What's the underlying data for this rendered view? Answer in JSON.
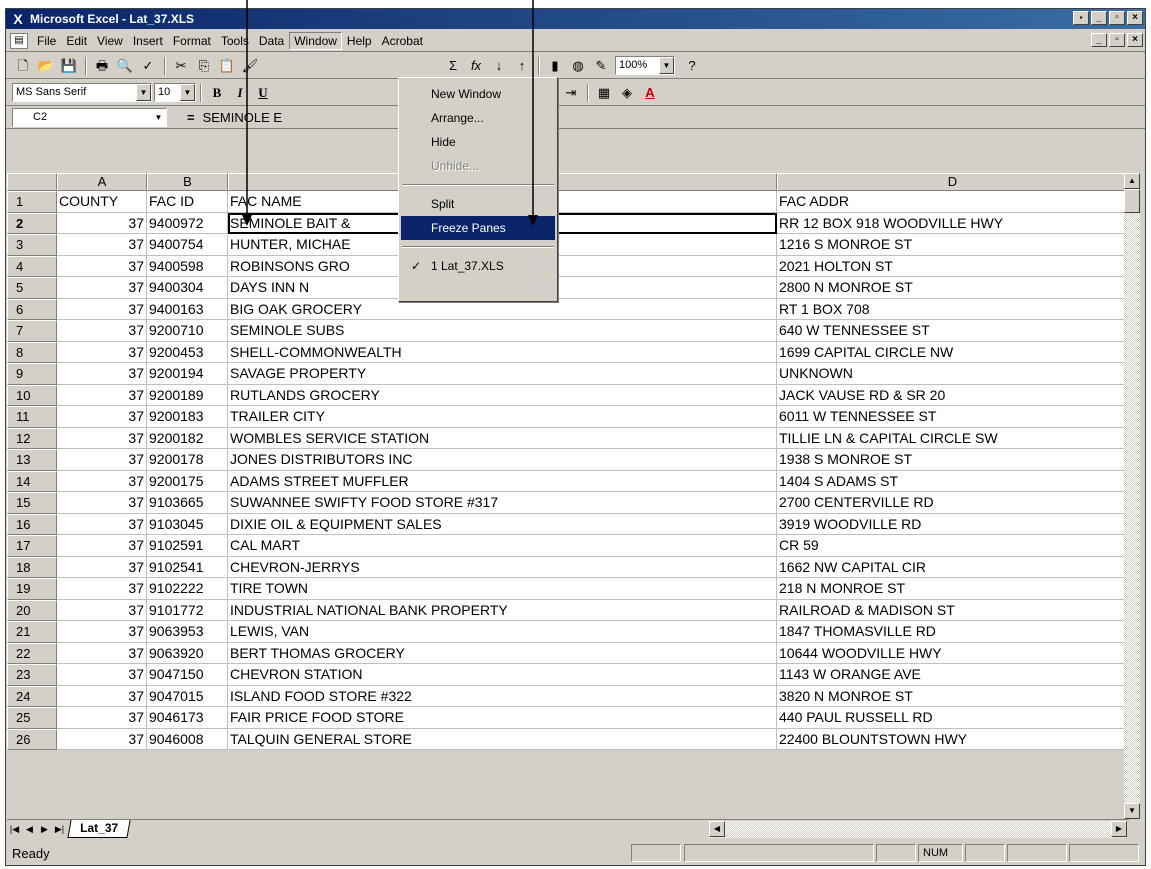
{
  "window": {
    "title": "Microsoft Excel - Lat_37.XLS",
    "app_icon": "excel-icon"
  },
  "menu": {
    "items": [
      "File",
      "Edit",
      "View",
      "Insert",
      "Format",
      "Tools",
      "Data",
      "Window",
      "Help",
      "Acrobat"
    ],
    "open": "Window"
  },
  "window_menu": {
    "new_window": "New Window",
    "arrange": "Arrange...",
    "hide": "Hide",
    "unhide": "Unhide...",
    "split": "Split",
    "freeze_panes": "Freeze Panes",
    "workbook": "1 Lat_37.XLS",
    "highlighted": "Freeze Panes"
  },
  "toolbar": {
    "zoom": "100%",
    "font_name": "MS Sans Serif",
    "font_size": "10",
    "bold": "B",
    "italic": "I",
    "underline": "U",
    "percent": "%",
    "comma": ","
  },
  "formula_bar": {
    "name_box": "C2",
    "equals": "=",
    "value": "SEMINOLE E"
  },
  "columns": [
    "A",
    "B",
    "",
    "D"
  ],
  "rows": [
    {
      "n": "1",
      "a": "COUNTY",
      "b": "FAC ID",
      "c": "FAC NAME",
      "d": "FAC ADDR"
    },
    {
      "n": "2",
      "a": "37",
      "b": "9400972",
      "c": "SEMINOLE BAIT &",
      "d": "RR 12 BOX 918 WOODVILLE HWY"
    },
    {
      "n": "3",
      "a": "37",
      "b": "9400754",
      "c": "HUNTER, MICHAE",
      "d": "1216 S MONROE ST"
    },
    {
      "n": "4",
      "a": "37",
      "b": "9400598",
      "c": "ROBINSONS GRO",
      "d": "2021 HOLTON ST"
    },
    {
      "n": "5",
      "a": "37",
      "b": "9400304",
      "c": "DAYS INN N",
      "d": "2800 N MONROE ST"
    },
    {
      "n": "6",
      "a": "37",
      "b": "9400163",
      "c": "BIG OAK GROCERY",
      "d": "RT 1 BOX 708"
    },
    {
      "n": "7",
      "a": "37",
      "b": "9200710",
      "c": "SEMINOLE SUBS",
      "d": "640 W TENNESSEE ST"
    },
    {
      "n": "8",
      "a": "37",
      "b": "9200453",
      "c": "SHELL-COMMONWEALTH",
      "d": "1699 CAPITAL CIRCLE NW"
    },
    {
      "n": "9",
      "a": "37",
      "b": "9200194",
      "c": "SAVAGE PROPERTY",
      "d": "UNKNOWN"
    },
    {
      "n": "10",
      "a": "37",
      "b": "9200189",
      "c": "RUTLANDS GROCERY",
      "d": "JACK VAUSE RD & SR 20"
    },
    {
      "n": "11",
      "a": "37",
      "b": "9200183",
      "c": "TRAILER CITY",
      "d": "6011 W TENNESSEE ST"
    },
    {
      "n": "12",
      "a": "37",
      "b": "9200182",
      "c": "WOMBLES SERVICE STATION",
      "d": "TILLIE LN & CAPITAL CIRCLE SW"
    },
    {
      "n": "13",
      "a": "37",
      "b": "9200178",
      "c": "JONES DISTRIBUTORS INC",
      "d": "1938 S MONROE ST"
    },
    {
      "n": "14",
      "a": "37",
      "b": "9200175",
      "c": "ADAMS STREET MUFFLER",
      "d": "1404 S ADAMS ST"
    },
    {
      "n": "15",
      "a": "37",
      "b": "9103665",
      "c": "SUWANNEE SWIFTY FOOD STORE #317",
      "d": "2700 CENTERVILLE RD"
    },
    {
      "n": "16",
      "a": "37",
      "b": "9103045",
      "c": "DIXIE OIL & EQUIPMENT SALES",
      "d": "3919 WOODVILLE RD"
    },
    {
      "n": "17",
      "a": "37",
      "b": "9102591",
      "c": "CAL MART",
      "d": "CR 59"
    },
    {
      "n": "18",
      "a": "37",
      "b": "9102541",
      "c": "CHEVRON-JERRYS",
      "d": "1662 NW CAPITAL CIR"
    },
    {
      "n": "19",
      "a": "37",
      "b": "9102222",
      "c": "TIRE TOWN",
      "d": "218 N MONROE ST"
    },
    {
      "n": "20",
      "a": "37",
      "b": "9101772",
      "c": "INDUSTRIAL NATIONAL BANK PROPERTY",
      "d": "RAILROAD & MADISON ST"
    },
    {
      "n": "21",
      "a": "37",
      "b": "9063953",
      "c": "LEWIS, VAN",
      "d": "1847 THOMASVILLE RD"
    },
    {
      "n": "22",
      "a": "37",
      "b": "9063920",
      "c": "BERT THOMAS GROCERY",
      "d": "10644 WOODVILLE HWY"
    },
    {
      "n": "23",
      "a": "37",
      "b": "9047150",
      "c": "CHEVRON STATION",
      "d": "1143 W ORANGE AVE"
    },
    {
      "n": "24",
      "a": "37",
      "b": "9047015",
      "c": "ISLAND FOOD STORE #322",
      "d": "3820 N MONROE ST"
    },
    {
      "n": "25",
      "a": "37",
      "b": "9046173",
      "c": "FAIR PRICE FOOD STORE",
      "d": "440 PAUL RUSSELL RD"
    },
    {
      "n": "26",
      "a": "37",
      "b": "9046008",
      "c": "TALQUIN GENERAL STORE",
      "d": "22400 BLOUNTSTOWN HWY"
    }
  ],
  "active_row": "2",
  "sheet_tab": "Lat_37",
  "status": {
    "left": "Ready",
    "num": "NUM"
  }
}
